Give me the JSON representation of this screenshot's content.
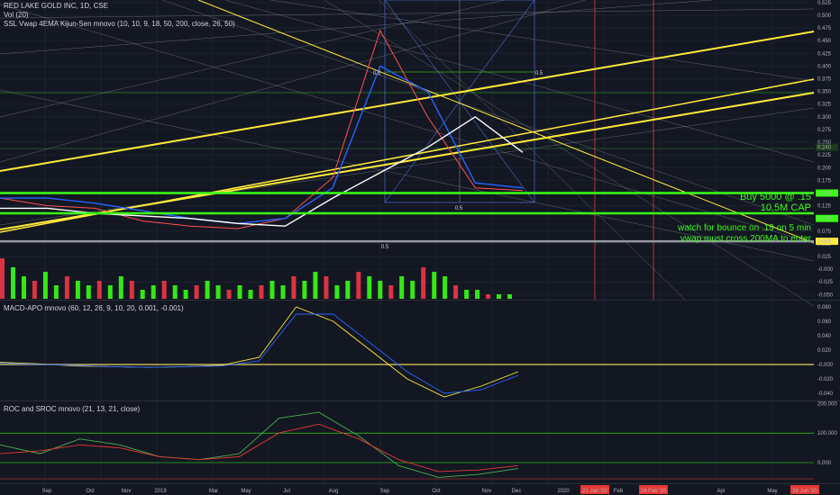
{
  "header": {
    "symbol": "RED LAKE GOLD INC, 1D, CSE",
    "volume_indicator": "Vol (20)",
    "overlay_indicator": "SSL Vwap 4EMA Kijun-Sen mnovo (10, 10, 9, 18, 50, 200, close, 26, 50)"
  },
  "colors": {
    "background": "#131722",
    "green_level": "#39ff14",
    "yellow_trend": "#ffeb3b",
    "annotation": "#39ff14",
    "red_vline": "#e53935"
  },
  "annotations": {
    "buy": "Buy 5000 @ .15",
    "cap": "10.5M CAP",
    "bounce": "watch for bounce on .19 on 5 min",
    "vwap": "vwap must cross 200MA to enter",
    "fib_half": "0.5"
  },
  "chart_data": [
    {
      "type": "line",
      "pane": "price",
      "x": [
        "Sep",
        "Oct",
        "Nov",
        "2019",
        "Mar",
        "May",
        "Jul",
        "Aug",
        "Sep",
        "Oct",
        "Nov",
        "Dec"
      ],
      "series": [
        {
          "values": [
            0.14,
            0.125,
            0.12,
            0.095,
            0.085,
            0.08,
            0.1,
            0.18,
            0.47,
            0.3,
            0.16,
            0.155
          ]
        },
        {
          "values": [
            0.14,
            0.14,
            0.13,
            0.115,
            0.1,
            0.09,
            0.1,
            0.16,
            0.4,
            0.35,
            0.17,
            0.16
          ]
        },
        {
          "values": [
            0.12,
            0.12,
            0.11,
            0.105,
            0.1,
            0.09,
            0.085,
            0.14,
            0.19,
            0.24,
            0.3,
            0.23
          ]
        }
      ],
      "y_ticks": [
        "0.525",
        "0.500",
        "0.475",
        "0.450",
        "0.425",
        "0.400",
        "0.375",
        "0.350",
        "0.325",
        "0.300",
        "0.275",
        "0.250",
        "0.225",
        "0.200",
        "0.175",
        "0.150",
        "0.125",
        "0.100",
        "0.075",
        "0.050",
        "0.025",
        "-0.000",
        "-0.025",
        "-0.050"
      ],
      "price_badges": [
        "0.240",
        "0.150",
        "0.100",
        "0.055"
      ],
      "levels": [
        0.15,
        0.11,
        0.055
      ],
      "ylim": [
        -0.06,
        0.53
      ]
    },
    {
      "type": "bar",
      "pane": "volume",
      "values": [
        9,
        7,
        5,
        4,
        6,
        3,
        5,
        4,
        3,
        4,
        3,
        5,
        4,
        2,
        3,
        4,
        3,
        2,
        3,
        4,
        3,
        2,
        3,
        2,
        3,
        4,
        3,
        5,
        4,
        6,
        5,
        3,
        4,
        6,
        5,
        4,
        3,
        5,
        4,
        7,
        6,
        5,
        3,
        2,
        2,
        1,
        1,
        1
      ]
    },
    {
      "type": "line",
      "pane": "macd",
      "title": "MACD-APO mnovo (60, 12, 26, 9, 10, 20, 0.001, -0.001)",
      "series": [
        {
          "values": [
            0.003,
            0.001,
            -0.002,
            -0.003,
            -0.004,
            -0.003,
            -0.001,
            0.01,
            0.08,
            0.06,
            0.02,
            -0.02,
            -0.045,
            -0.03,
            -0.01
          ]
        },
        {
          "values": [
            0.002,
            0.0,
            -0.001,
            -0.003,
            -0.004,
            -0.003,
            -0.002,
            0.005,
            0.07,
            0.07,
            0.03,
            -0.01,
            -0.04,
            -0.035,
            -0.015
          ]
        }
      ],
      "y_ticks": [
        "0.080",
        "0.060",
        "0.040",
        "0.020",
        "-0.000",
        "-0.020",
        "-0.040"
      ],
      "ylim": [
        -0.05,
        0.09
      ]
    },
    {
      "type": "line",
      "pane": "roc",
      "title": "ROC and SROC mnovo (21, 13, 21, close)",
      "series": [
        {
          "values": [
            60,
            30,
            80,
            60,
            20,
            10,
            30,
            150,
            170,
            90,
            -10,
            -50,
            -40,
            -20
          ]
        },
        {
          "values": [
            30,
            40,
            60,
            50,
            20,
            10,
            20,
            100,
            130,
            80,
            10,
            -30,
            -25,
            -10
          ]
        }
      ],
      "y_ticks": [
        "200.000",
        "100.000",
        "0.000"
      ],
      "ylim": [
        -70,
        210
      ]
    }
  ],
  "time_axis": {
    "labels": [
      "Sep",
      "Oct",
      "Nov",
      "2019",
      "Mar",
      "May",
      "Jul",
      "Aug",
      "Sep",
      "Oct",
      "Nov",
      "Dec",
      "2020",
      "Feb",
      "Apr",
      "May"
    ],
    "highlighted": [
      "21 Jan '20",
      "24 Feb '20",
      "26 Jun '20"
    ]
  }
}
